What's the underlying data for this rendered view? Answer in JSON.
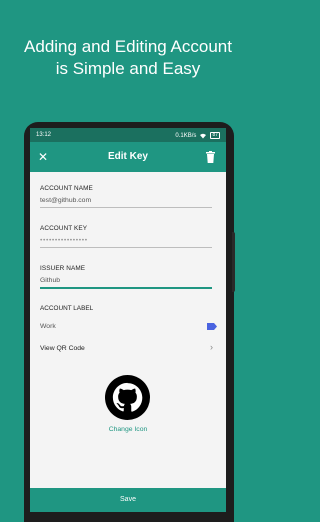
{
  "headline": {
    "line1": "Adding and Editing Account",
    "line2": "is Simple and Easy"
  },
  "status": {
    "time": "13:12",
    "net": "0.1KB/s",
    "battery": "87"
  },
  "appbar": {
    "title": "Edit Key",
    "close_glyph": "✕"
  },
  "fields": {
    "account_name": {
      "label": "ACCOUNT NAME",
      "value": "test@github.com"
    },
    "account_key": {
      "label": "ACCOUNT KEY",
      "value": "••••••••••••••••"
    },
    "issuer_name": {
      "label": "ISSUER NAME",
      "value": "Github"
    },
    "account_label": {
      "label": "ACCOUNT LABEL",
      "value": "Work"
    }
  },
  "qr": {
    "label": "View QR Code",
    "chevron": "›"
  },
  "logo": {
    "change_label": "Change Icon"
  },
  "save": {
    "label": "Save"
  },
  "colors": {
    "accent": "#1f9682",
    "status_bar": "#1b705f",
    "tag": "#4a63e0"
  },
  "icons": [
    "close-icon",
    "trash-icon",
    "tag-icon",
    "chevron-right-icon",
    "github-logo-icon"
  ]
}
